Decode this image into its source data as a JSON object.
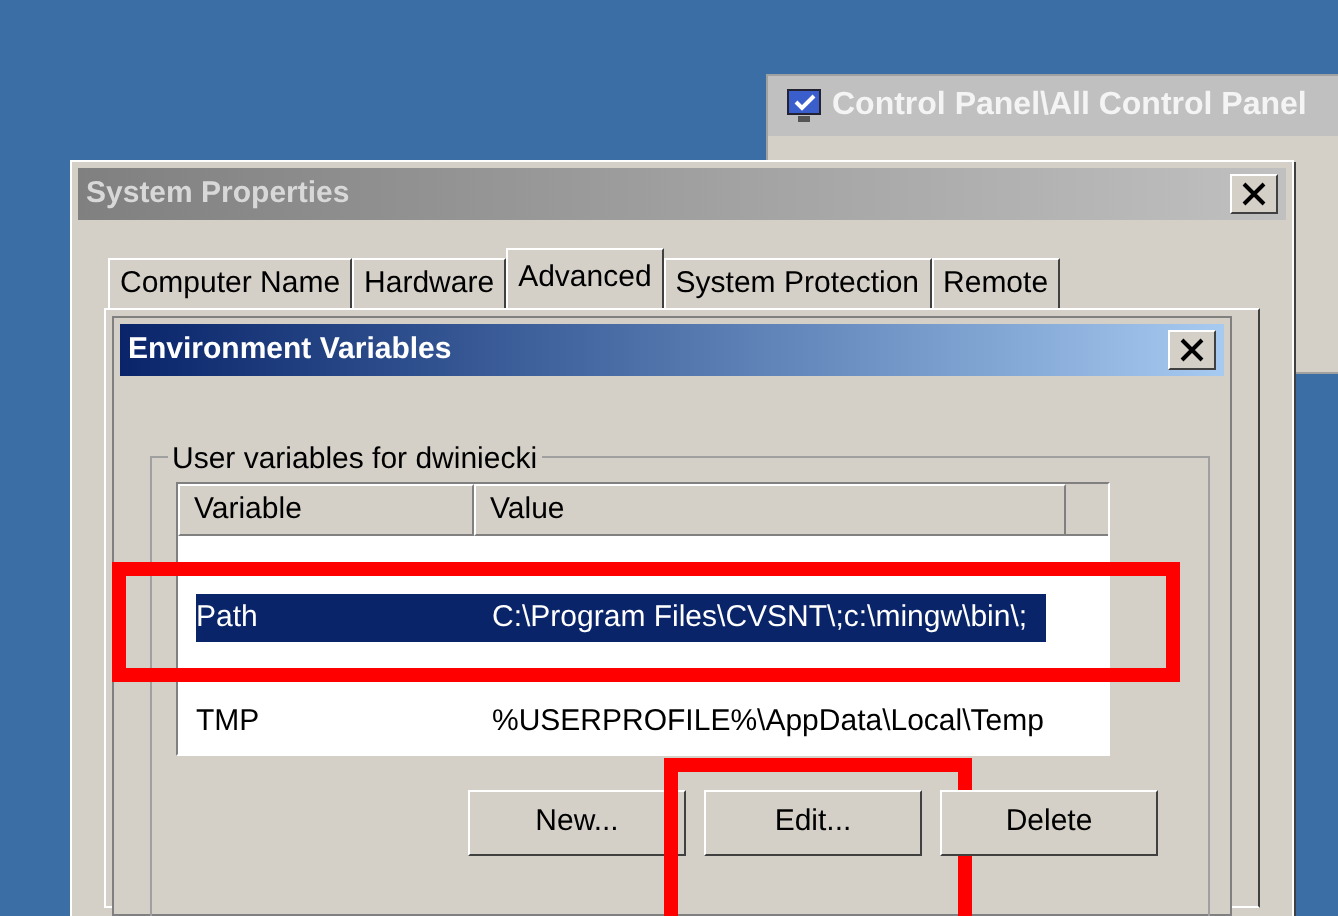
{
  "background_window": {
    "title": "Control Panel\\All Control Panel"
  },
  "dialog": {
    "title": "System Properties",
    "tabs": [
      {
        "label": "Computer Name",
        "selected": false
      },
      {
        "label": "Hardware",
        "selected": false
      },
      {
        "label": "Advanced",
        "selected": true
      },
      {
        "label": "System Protection",
        "selected": false
      },
      {
        "label": "Remote",
        "selected": false
      }
    ]
  },
  "env_dialog": {
    "title": "Environment Variables",
    "group_label": "User variables for dwiniecki",
    "columns": [
      "Variable",
      "Value"
    ],
    "rows": [
      {
        "kind": "obscured"
      },
      {
        "kind": "entry",
        "variable": "Path",
        "value": "C:\\Program Files\\CVSNT\\;c:\\mingw\\bin\\;",
        "selected": true,
        "highlighted": true
      },
      {
        "kind": "obscured"
      },
      {
        "kind": "entry",
        "variable": "TMP",
        "value": "%USERPROFILE%\\AppData\\Local\\Temp",
        "selected": false,
        "highlighted": false
      }
    ],
    "buttons": [
      {
        "label": "New...",
        "highlighted": false
      },
      {
        "label": "Edit...",
        "highlighted": true
      },
      {
        "label": "Delete",
        "highlighted": false
      }
    ]
  }
}
